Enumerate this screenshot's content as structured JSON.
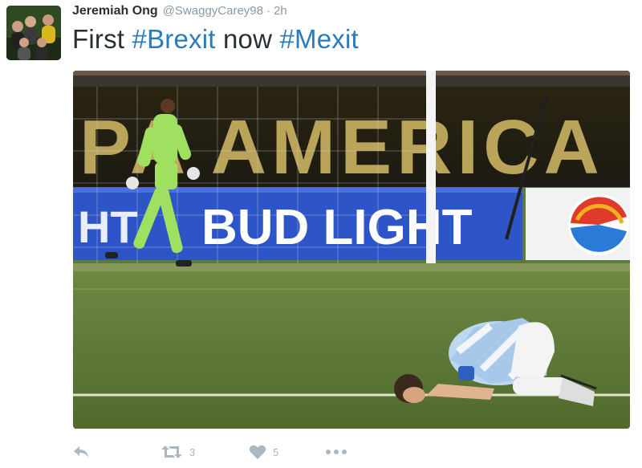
{
  "tweet": {
    "author_name": "Jeremiah Ong",
    "author_handle": "@SwaggyCarey98",
    "separator": "·",
    "timestamp": "2h",
    "text_prefix": "First ",
    "hashtag_1": "#Brexit",
    "text_middle": " now ",
    "hashtag_2": "#Mexit"
  },
  "media": {
    "banner_text": "PA AMERICA",
    "sponsor_text": "BUD LIGHT",
    "sponsor_text_left": "HT"
  },
  "actions": {
    "retweet_count": "3",
    "like_count": "5"
  },
  "icons": {
    "reply": "reply-icon",
    "retweet": "retweet-icon",
    "like": "heart-icon",
    "more": "more-dots-icon"
  },
  "colors": {
    "hashtag": "#2b7bb9",
    "muted": "#8899a6",
    "action_gray": "#aab8c2",
    "text": "#292f33"
  }
}
